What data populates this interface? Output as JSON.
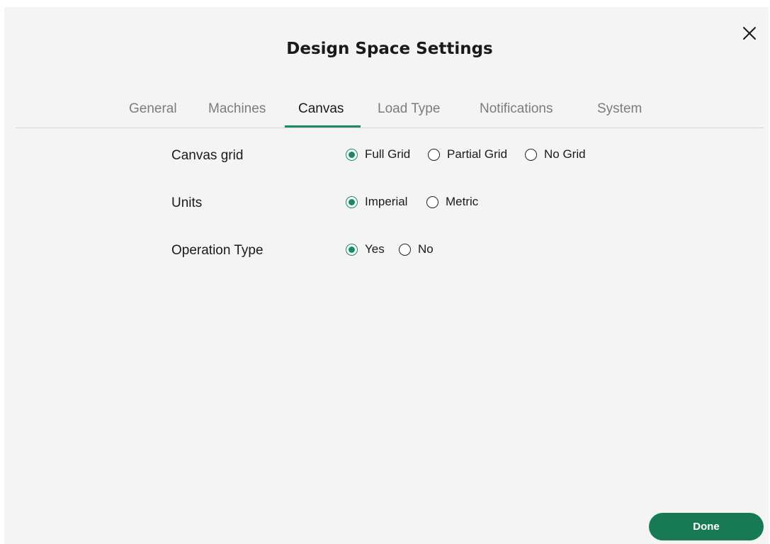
{
  "dialog": {
    "title": "Design Space Settings",
    "close_icon": "close-icon"
  },
  "tabs": [
    {
      "label": "General",
      "active": false
    },
    {
      "label": "Machines",
      "active": false
    },
    {
      "label": "Canvas",
      "active": true
    },
    {
      "label": "Load Type",
      "active": false
    },
    {
      "label": "Notifications",
      "active": false
    },
    {
      "label": "System",
      "active": false
    }
  ],
  "settings": {
    "canvas_grid": {
      "label": "Canvas grid",
      "options": [
        "Full Grid",
        "Partial Grid",
        "No Grid"
      ],
      "selected": "Full Grid"
    },
    "units": {
      "label": "Units",
      "options": [
        "Imperial",
        "Metric"
      ],
      "selected": "Imperial"
    },
    "operation_type": {
      "label": "Operation Type",
      "options": [
        "Yes",
        "No"
      ],
      "selected": "Yes"
    }
  },
  "footer": {
    "done_label": "Done"
  },
  "colors": {
    "accent": "#1b8a64",
    "done_button": "#177a55",
    "dialog_background": "#f4f4f4"
  }
}
